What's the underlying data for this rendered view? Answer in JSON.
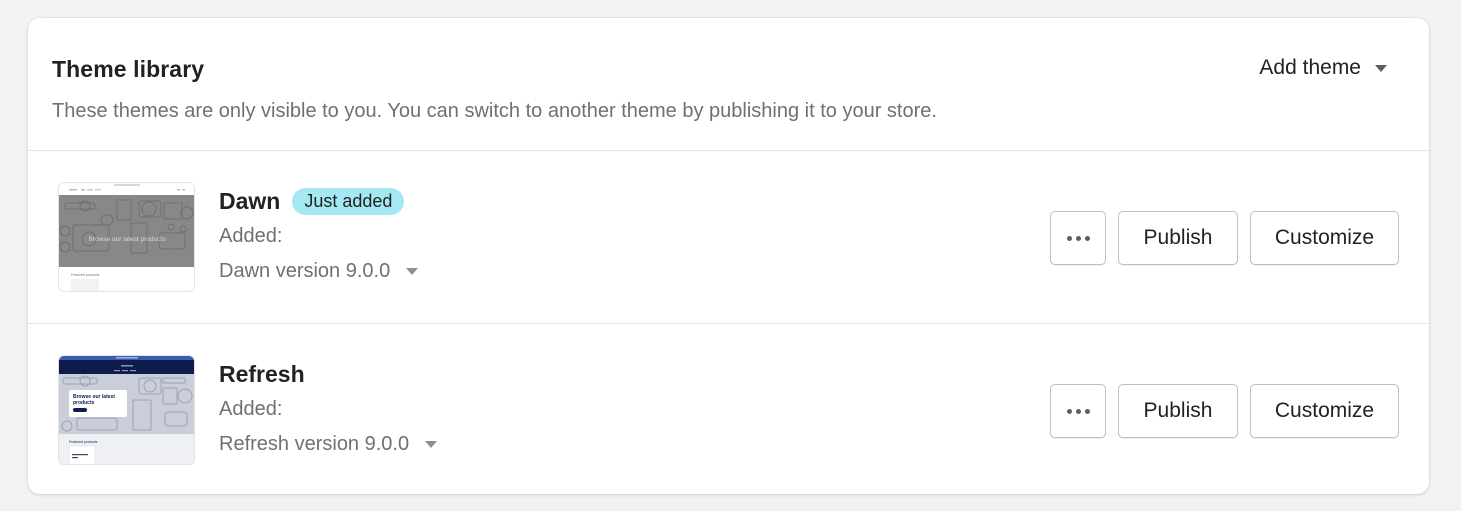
{
  "header": {
    "title": "Theme library",
    "subtitle": "These themes are only visible to you. You can switch to another theme by publishing it to your store.",
    "add_theme_label": "Add theme"
  },
  "themes": [
    {
      "name": "Dawn",
      "badge": "Just added",
      "added_label": "Added:",
      "version": "Dawn version 9.0.0",
      "thumbnail_text": "Browse our latest products",
      "thumbnail_section": "Featured products",
      "thumbnail_style": "grayscale",
      "more_label": "More actions",
      "publish_label": "Publish",
      "customize_label": "Customize"
    },
    {
      "name": "Refresh",
      "badge": null,
      "added_label": "Added:",
      "version": "Refresh version 9.0.0",
      "thumbnail_text": "Browse our latest products",
      "thumbnail_section": "Featured products",
      "thumbnail_style": "navy",
      "more_label": "More actions",
      "publish_label": "Publish",
      "customize_label": "Customize"
    }
  ],
  "colors": {
    "badge_bg": "#a4e8f2",
    "refresh_nav": "#0e1b4d",
    "dawn_hero": "#8a8a8a"
  }
}
